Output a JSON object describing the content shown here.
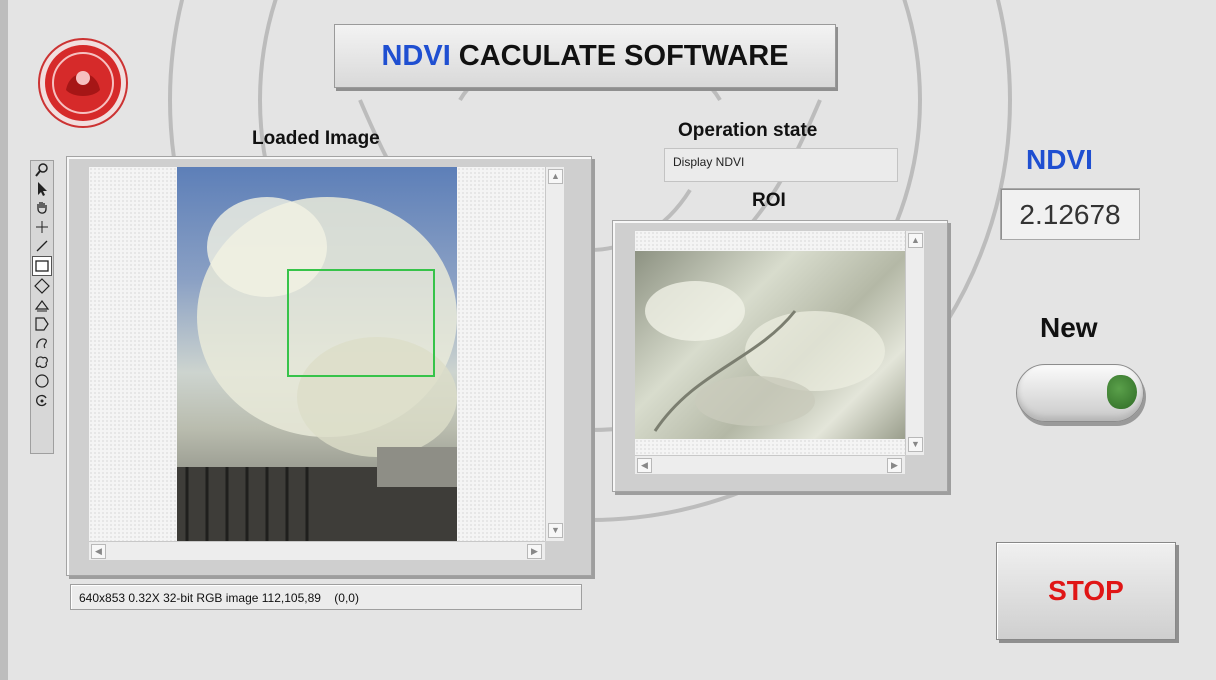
{
  "app": {
    "title_accent": "NDVI",
    "title_rest": "CACULATE SOFTWARE"
  },
  "loaded_image": {
    "label": "Loaded Image",
    "status_text": "640x853 0.32X 32-bit RGB image 112,105,89    (0,0)"
  },
  "operation": {
    "label": "Operation state",
    "value": "Display NDVI"
  },
  "roi": {
    "label": "ROI"
  },
  "ndvi": {
    "label": "NDVI",
    "value": "2.12678"
  },
  "new_control": {
    "label": "New"
  },
  "stop_button": {
    "label": "STOP"
  },
  "tools": [
    "zoom-icon",
    "select-arrow-icon",
    "pan-hand-icon",
    "crosshair-point-icon",
    "line-icon",
    "rectangle-icon",
    "rotated-rectangle-icon",
    "annulus-icon",
    "polygon-icon",
    "freehand-icon",
    "freehand-region-icon",
    "oval-icon",
    "rotate-icon"
  ],
  "colors": {
    "accent_blue": "#1f4fd1",
    "stop_red": "#e01616",
    "roi_green": "#37c34a",
    "led_green": "#3f8a34"
  }
}
